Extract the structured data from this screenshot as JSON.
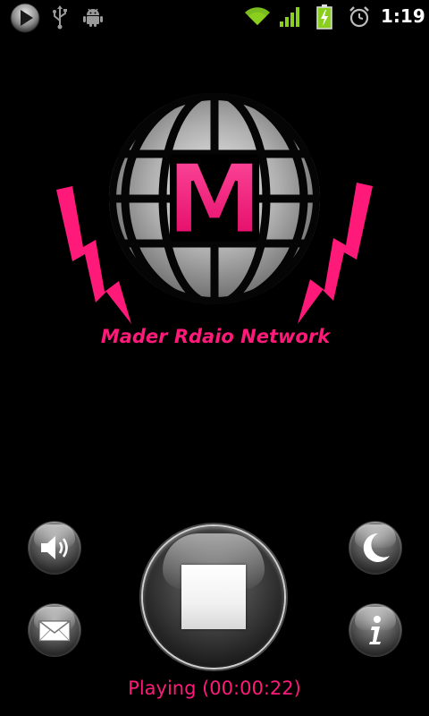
{
  "status_bar": {
    "time": "1:19",
    "icons": [
      "media-play-icon",
      "usb-icon",
      "android-debug-icon",
      "wifi-icon",
      "cell-signal-icon",
      "battery-charging-icon",
      "alarm-clock-icon"
    ]
  },
  "logo": {
    "letter": "M",
    "tagline": "Mader Rdaio Network",
    "accent_color": "#ff1a7a"
  },
  "controls": {
    "left": [
      "volume-icon",
      "mail-icon"
    ],
    "center": "stop-icon",
    "right": [
      "sleep-moon-icon",
      "info-icon"
    ]
  },
  "player": {
    "status": "Playing (00:00:22)"
  }
}
